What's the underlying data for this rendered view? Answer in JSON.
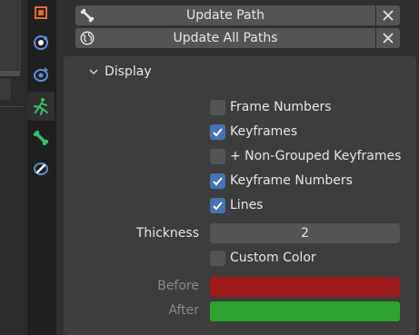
{
  "operators": {
    "update_path": {
      "label": "Update Path",
      "icon": "bone-icon"
    },
    "update_all_paths": {
      "label": "Update All Paths",
      "icon": "world-icon"
    }
  },
  "display": {
    "title": "Display",
    "expanded": true,
    "frame_numbers": {
      "label": "Frame Numbers",
      "checked": false
    },
    "keyframes": {
      "label": "Keyframes",
      "checked": true
    },
    "non_grouped": {
      "label": "+ Non-Grouped Keyframes",
      "checked": false
    },
    "keyframe_numbers": {
      "label": "Keyframe Numbers",
      "checked": true
    },
    "lines": {
      "label": "Lines",
      "checked": true
    },
    "thickness": {
      "label": "Thickness",
      "value": "2"
    },
    "custom_color": {
      "label": "Custom Color",
      "checked": false
    },
    "before": {
      "label": "Before",
      "color": "#9e1c1c"
    },
    "after": {
      "label": "After",
      "color": "#2ca32c"
    }
  },
  "tabs": [
    {
      "name": "object-tab",
      "icon": "object-icon",
      "active": false
    },
    {
      "name": "physics-tab",
      "icon": "physics-icon",
      "active": false
    },
    {
      "name": "constraints-tab",
      "icon": "constraint-icon",
      "active": false
    },
    {
      "name": "armature-tab",
      "icon": "armature-icon",
      "active": true
    },
    {
      "name": "bone-tab",
      "icon": "bone-icon",
      "active": false
    },
    {
      "name": "bone-constraints-tab",
      "icon": "bone-constraint-icon",
      "active": false
    }
  ],
  "colors": {
    "checked": "#4772b3",
    "unchecked": "#545454",
    "accent_orange": "#e0702d",
    "accent_blue": "#5b8fd8",
    "accent_green": "#38c06a"
  }
}
